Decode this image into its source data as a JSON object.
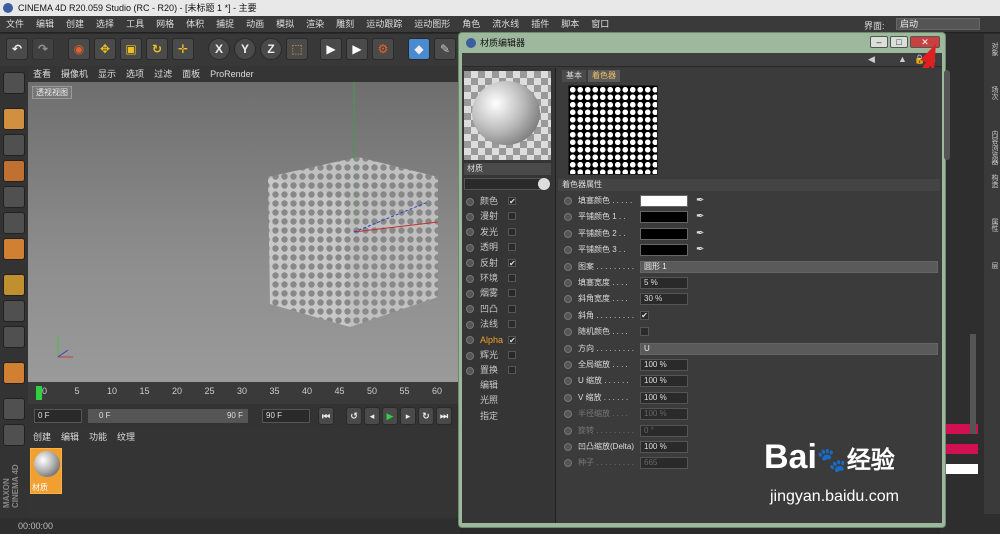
{
  "app": {
    "title": "CINEMA 4D R20.059 Studio (RC - R20) - [未标题 1 *] - 主要"
  },
  "menu": [
    "文件",
    "编辑",
    "创建",
    "选择",
    "工具",
    "网格",
    "体积",
    "捕捉",
    "动画",
    "模拟",
    "渲染",
    "雕刻",
    "运动跟踪",
    "运动图形",
    "角色",
    "流水线",
    "插件",
    "脚本",
    "窗口"
  ],
  "layout_label": "界面:",
  "layout_value": "启动",
  "viewport": {
    "menu": [
      "查看",
      "摄像机",
      "显示",
      "选项",
      "过滤",
      "面板",
      "ProRender"
    ],
    "label": "透视视图"
  },
  "timeline": {
    "ticks": [
      "0",
      "5",
      "10",
      "15",
      "20",
      "25",
      "30",
      "35",
      "40",
      "45",
      "50",
      "55",
      "60"
    ],
    "start": "0 F",
    "range_start": "0 F",
    "range_end": "90 F",
    "end": "90 F"
  },
  "material_manager": {
    "menu": [
      "创建",
      "编辑",
      "功能",
      "纹理"
    ],
    "item": "材质"
  },
  "status": {
    "time": "00:00:00"
  },
  "right_tabs": [
    "对象",
    "场次",
    "内容浏览器",
    "构造",
    "属性",
    "层"
  ],
  "dialog": {
    "title": "材质编辑器",
    "material_name": "材质",
    "tabs": [
      "基本",
      "着色器"
    ],
    "section": "着色器属性",
    "channels": [
      {
        "label": "颜色",
        "checked": "✔"
      },
      {
        "label": "漫射",
        "checked": ""
      },
      {
        "label": "发光",
        "checked": ""
      },
      {
        "label": "透明",
        "checked": ""
      },
      {
        "label": "反射",
        "checked": "✔"
      },
      {
        "label": "环境",
        "checked": ""
      },
      {
        "label": "烟雾",
        "checked": ""
      },
      {
        "label": "凹凸",
        "checked": ""
      },
      {
        "label": "法线",
        "checked": ""
      },
      {
        "label": "Alpha",
        "checked": "✔"
      },
      {
        "label": "辉光",
        "checked": ""
      },
      {
        "label": "置换",
        "checked": ""
      }
    ],
    "extra": [
      "编辑",
      "光照",
      "指定"
    ],
    "props": [
      {
        "label": "填塞颜色 . . . . .",
        "type": "swatch",
        "value": "white"
      },
      {
        "label": "平铺颜色 1 . .",
        "type": "swatch",
        "value": "black"
      },
      {
        "label": "平铺颜色 2 . .",
        "type": "swatch",
        "value": "black"
      },
      {
        "label": "平铺颜色 3 . .",
        "type": "swatch",
        "value": "black"
      },
      {
        "label": "图案 . . . . . . . . .",
        "type": "select",
        "value": "圆形 1"
      },
      {
        "label": "填塞宽度 . . . .",
        "type": "num",
        "value": "5 %"
      },
      {
        "label": "斜角宽度 . . . .",
        "type": "num",
        "value": "30 %"
      },
      {
        "label": "斜角 . . . . . . . . .",
        "type": "check",
        "value": "✔"
      },
      {
        "label": "随机颜色 . . . .",
        "type": "check",
        "value": ""
      },
      {
        "label": "方向 . . . . . . . . .",
        "type": "select",
        "value": "U"
      },
      {
        "label": "全局缩放 . . . .",
        "type": "num",
        "value": "100 %"
      },
      {
        "label": "U 缩放 . . . . . .",
        "type": "num",
        "value": "100 %"
      },
      {
        "label": "V 缩放 . . . . . .",
        "type": "num",
        "value": "100 %"
      },
      {
        "label": "半径缩放 . . . .",
        "type": "num",
        "value": "100 %",
        "dim": true
      },
      {
        "label": "旋转 . . . . . . . . .",
        "type": "num",
        "value": "0 °",
        "dim": true
      },
      {
        "label": "凹凸缩放(Delta)",
        "type": "num",
        "value": "100 %"
      },
      {
        "label": "种子 . . . . . . . . .",
        "type": "num",
        "value": "665",
        "dim": true
      }
    ]
  },
  "watermark": {
    "brand": "Bai",
    "brand2": "经验",
    "url": "jingyan.baidu.com"
  }
}
